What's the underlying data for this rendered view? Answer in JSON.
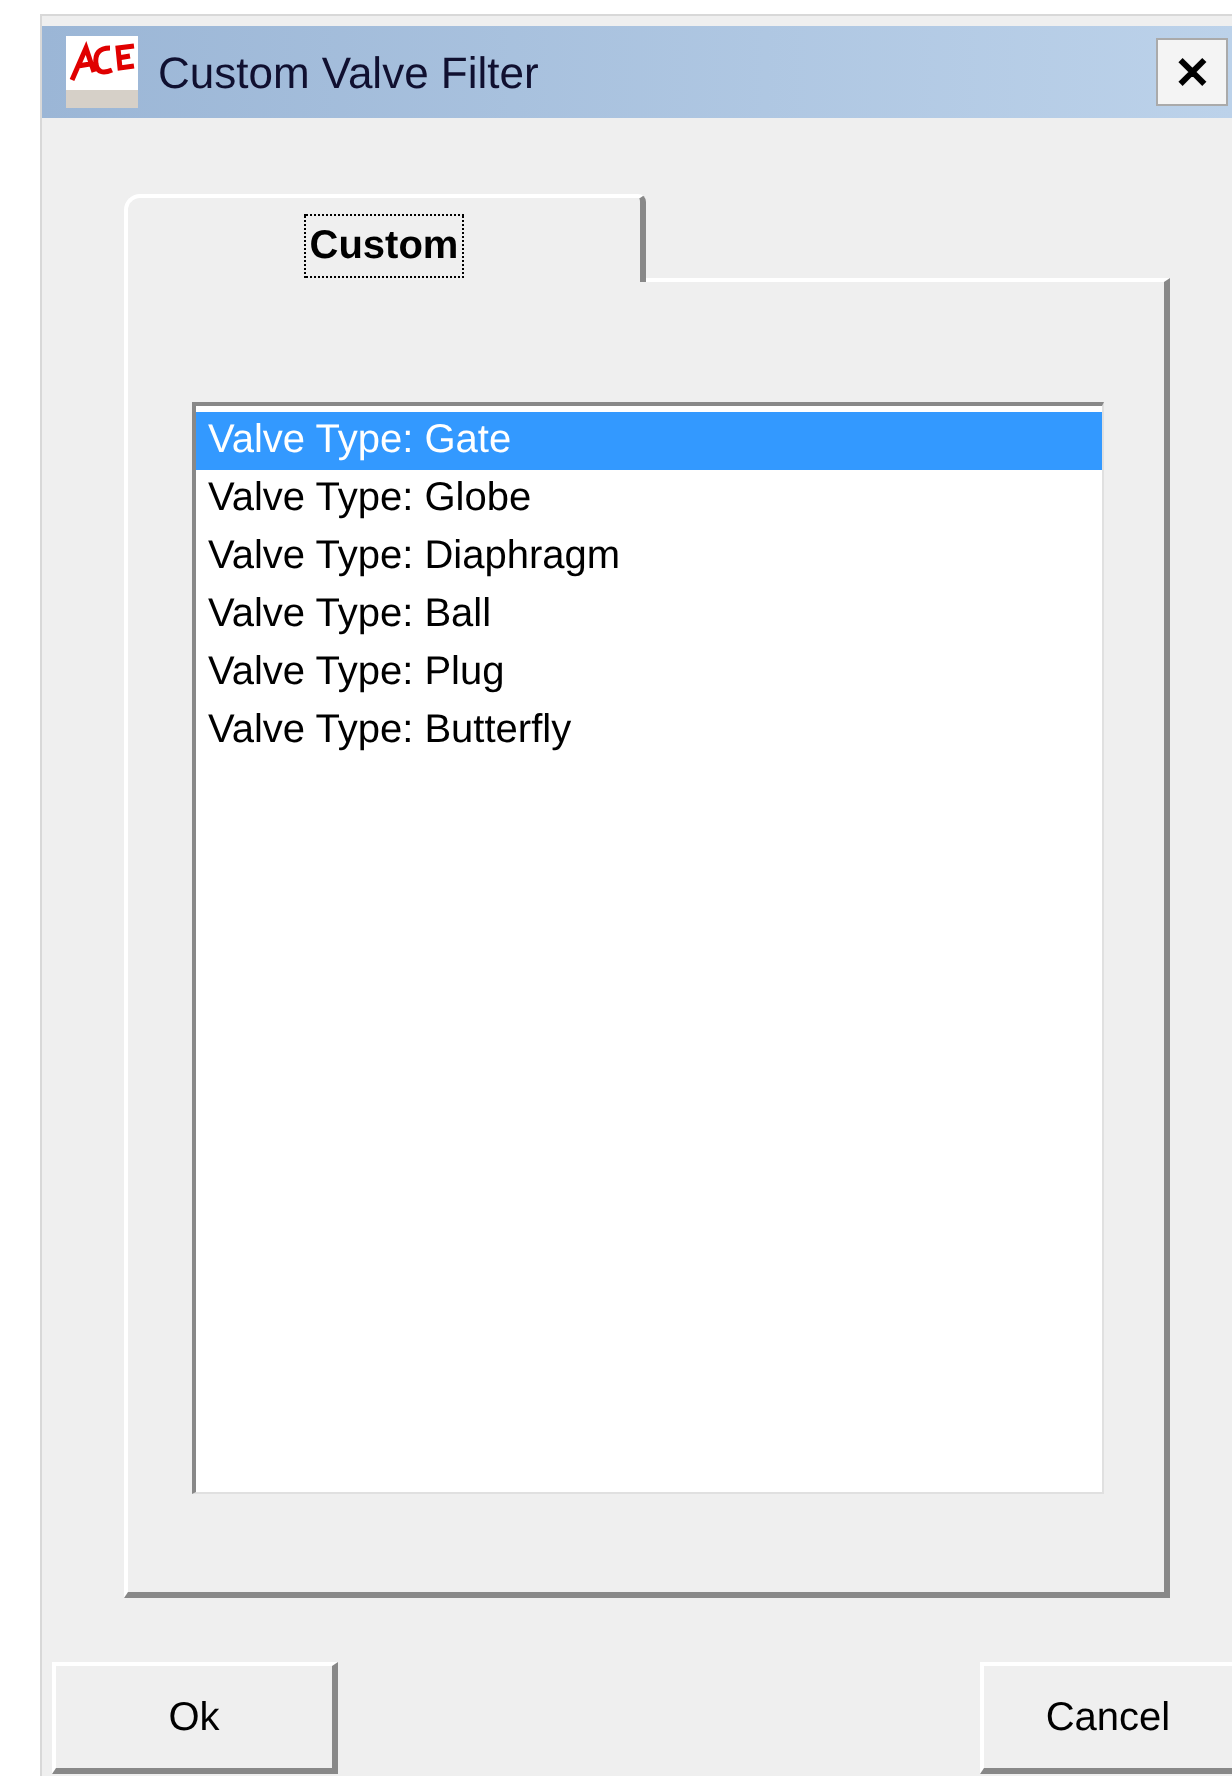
{
  "window": {
    "title": "Custom Valve Filter",
    "close": "✕"
  },
  "tabs": [
    {
      "label": "Custom",
      "selected": true
    }
  ],
  "list": [
    {
      "label": "Valve Type: Gate",
      "selected": true
    },
    {
      "label": "Valve Type: Globe",
      "selected": false
    },
    {
      "label": "Valve Type: Diaphragm",
      "selected": false
    },
    {
      "label": "Valve Type: Ball",
      "selected": false
    },
    {
      "label": "Valve Type: Plug",
      "selected": false
    },
    {
      "label": "Valve Type: Butterfly",
      "selected": false
    }
  ],
  "buttons": [
    "Ok",
    "Cancel"
  ]
}
